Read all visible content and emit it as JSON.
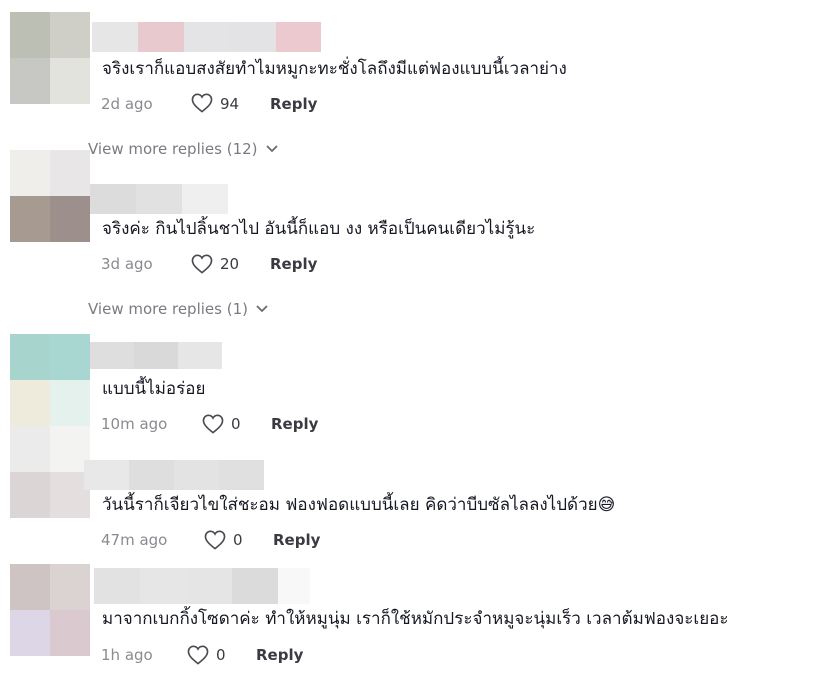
{
  "comments": [
    {
      "text": "จริงเราก็แอบสงสัยทำไมหมูกะทะชั่งโลถึงมีแต่ฟองแบบนี้เวลาย่าง",
      "time": "2d ago",
      "likes": "94",
      "reply_label": "Reply",
      "view_more": "View more replies (12)"
    },
    {
      "text": "จริงค่ะ กินไปลิ้นชาไป อันนี้ก็แอบ งง หรือเป็นคนเดียวไม่รู้นะ",
      "time": "3d ago",
      "likes": "20",
      "reply_label": "Reply",
      "view_more": "View more replies (1)"
    },
    {
      "text": "แบบนี้ไม่อร่อย",
      "time": "10m ago",
      "likes": "0",
      "reply_label": "Reply"
    },
    {
      "text": "วันนี้ราก็เจียวไขใส่ชะอม ฟองฟอดแบบนี้เลย คิดว่าบีบซัลไลลงไปด้วย😅",
      "time": "47m ago",
      "likes": "0",
      "reply_label": "Reply"
    },
    {
      "text": "มาจากเบกกิ้งโซดาค่ะ ทำให้หมูนุ่ม เราก็ใช้หมักประจำหมูจะนุ่มเร็ว เวลาต้มฟองจะเยอะ",
      "time": "1h ago",
      "likes": "0",
      "reply_label": "Reply"
    }
  ]
}
